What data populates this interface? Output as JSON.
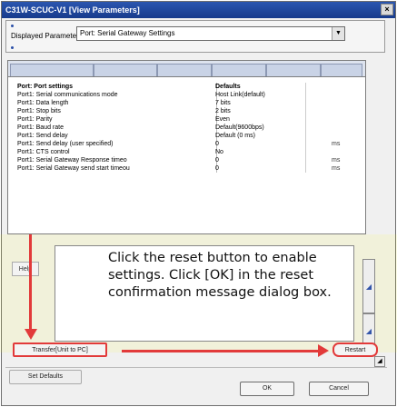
{
  "window": {
    "title": "C31W-SCUC-V1 [View Parameters]",
    "close_glyph": "×"
  },
  "display": {
    "label": "Displayed Parameter",
    "selected": "Port: Serial Gateway Settings"
  },
  "table": {
    "header": {
      "name": "Port: Port settings",
      "value": "Defaults"
    },
    "rows": [
      {
        "name": "Port1: Serial communications mode",
        "value": "Host Link(default)",
        "unit": ""
      },
      {
        "name": "Port1: Data length",
        "value": "7 bits",
        "unit": ""
      },
      {
        "name": "Port1: Stop bits",
        "value": "2 bits",
        "unit": ""
      },
      {
        "name": "Port1: Parity",
        "value": "Even",
        "unit": ""
      },
      {
        "name": "Port1: Baud rate",
        "value": "Default(9600bps)",
        "unit": ""
      },
      {
        "name": "Port1: Send delay",
        "value": "Default (0 ms)",
        "unit": ""
      },
      {
        "name": "Port1: Send delay (user specified)",
        "value": "0",
        "unit": "ms"
      },
      {
        "name": "Port1: CTS control",
        "value": "No",
        "unit": ""
      },
      {
        "name": "Port1: Serial Gateway Response timeo",
        "value": "0",
        "unit": "ms"
      },
      {
        "name": "Port1: Serial Gateway send start timeou",
        "value": "0",
        "unit": "ms"
      }
    ]
  },
  "help_label": "Help",
  "instruction": "Click the reset button to enable settings. Click [OK] in the reset confirmation message dialog box.",
  "buttons": {
    "transfer": "Transfer[Unit to PC]",
    "restart": "Restart",
    "set_defaults": "Set Defaults",
    "ok": "OK",
    "cancel": "Cancel"
  },
  "accent_colors": {
    "title_bar": "#1f4aa0",
    "annotation": "#e23a3a"
  }
}
